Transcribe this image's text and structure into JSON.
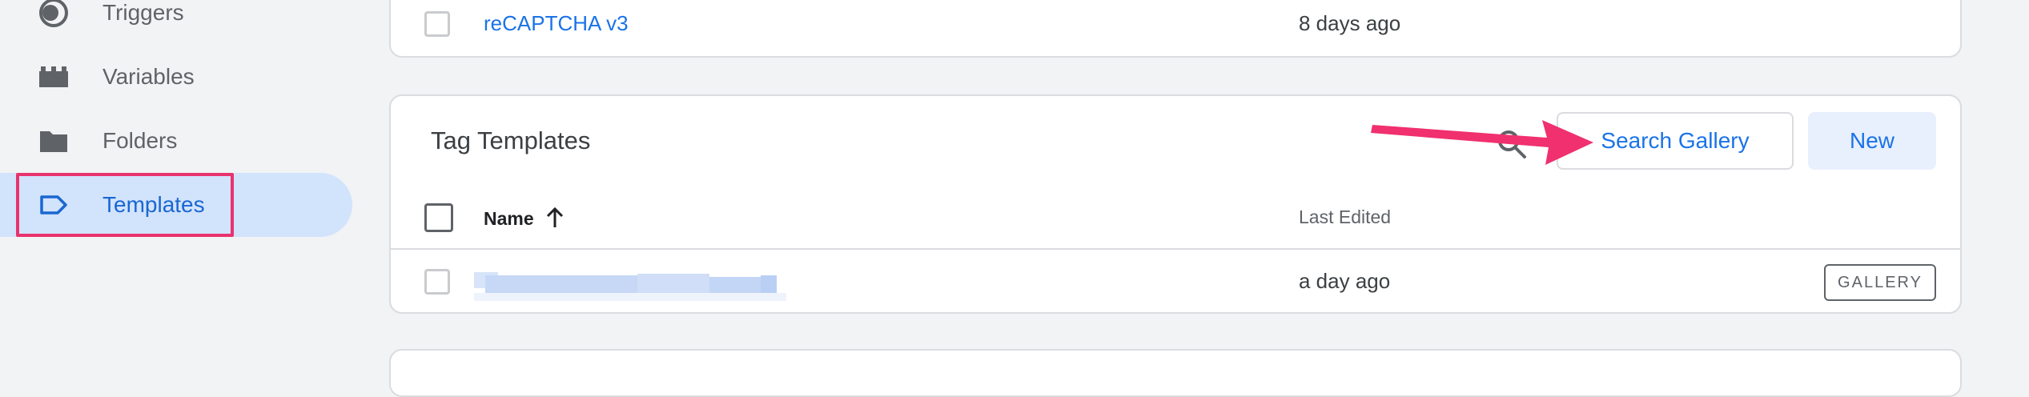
{
  "sidebar": {
    "items": [
      {
        "label": "Triggers",
        "icon": "triggers-icon"
      },
      {
        "label": "Variables",
        "icon": "variables-icon"
      },
      {
        "label": "Folders",
        "icon": "folder-icon"
      },
      {
        "label": "Templates",
        "icon": "templates-icon",
        "active": true
      }
    ]
  },
  "top_table": {
    "row": {
      "name": "reCAPTCHA v3",
      "last_edited": "8 days ago"
    }
  },
  "tag_templates": {
    "title": "Tag Templates",
    "search_gallery_label": "Search Gallery",
    "new_label": "New",
    "columns": {
      "name": "Name",
      "last_edited": "Last Edited"
    },
    "rows": [
      {
        "name": "",
        "last_edited": "a day ago",
        "badge": "GALLERY"
      }
    ]
  },
  "colors": {
    "accent": "#1a73e8",
    "active_nav_bg": "#d2e3fc",
    "annotation": "#e8336e",
    "page_bg": "#f1f3f4"
  }
}
